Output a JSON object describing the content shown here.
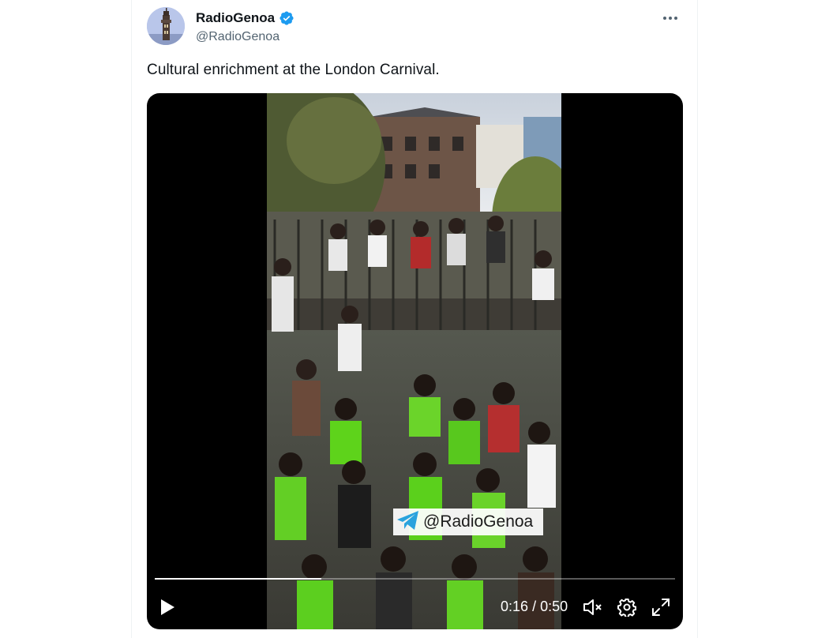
{
  "tweet": {
    "display_name": "RadioGenoa",
    "handle": "@RadioGenoa",
    "verified": true,
    "text": "Cultural enrichment at the London Carnival."
  },
  "video": {
    "watermark": "@RadioGenoa",
    "current_time": "0:16",
    "separator": "/",
    "duration": "0:50",
    "progress_fraction": 0.32,
    "muted": true
  },
  "icons": {
    "more": "more-icon",
    "verified": "verified-badge-icon",
    "play": "play-icon",
    "mute": "muted-icon",
    "settings": "gear-icon",
    "fullscreen": "fullscreen-icon",
    "telegram": "telegram-icon"
  },
  "colors": {
    "verified_blue": "#1d9bf0",
    "text_primary": "#0f1419",
    "text_secondary": "#536471",
    "video_bg": "#000000"
  }
}
